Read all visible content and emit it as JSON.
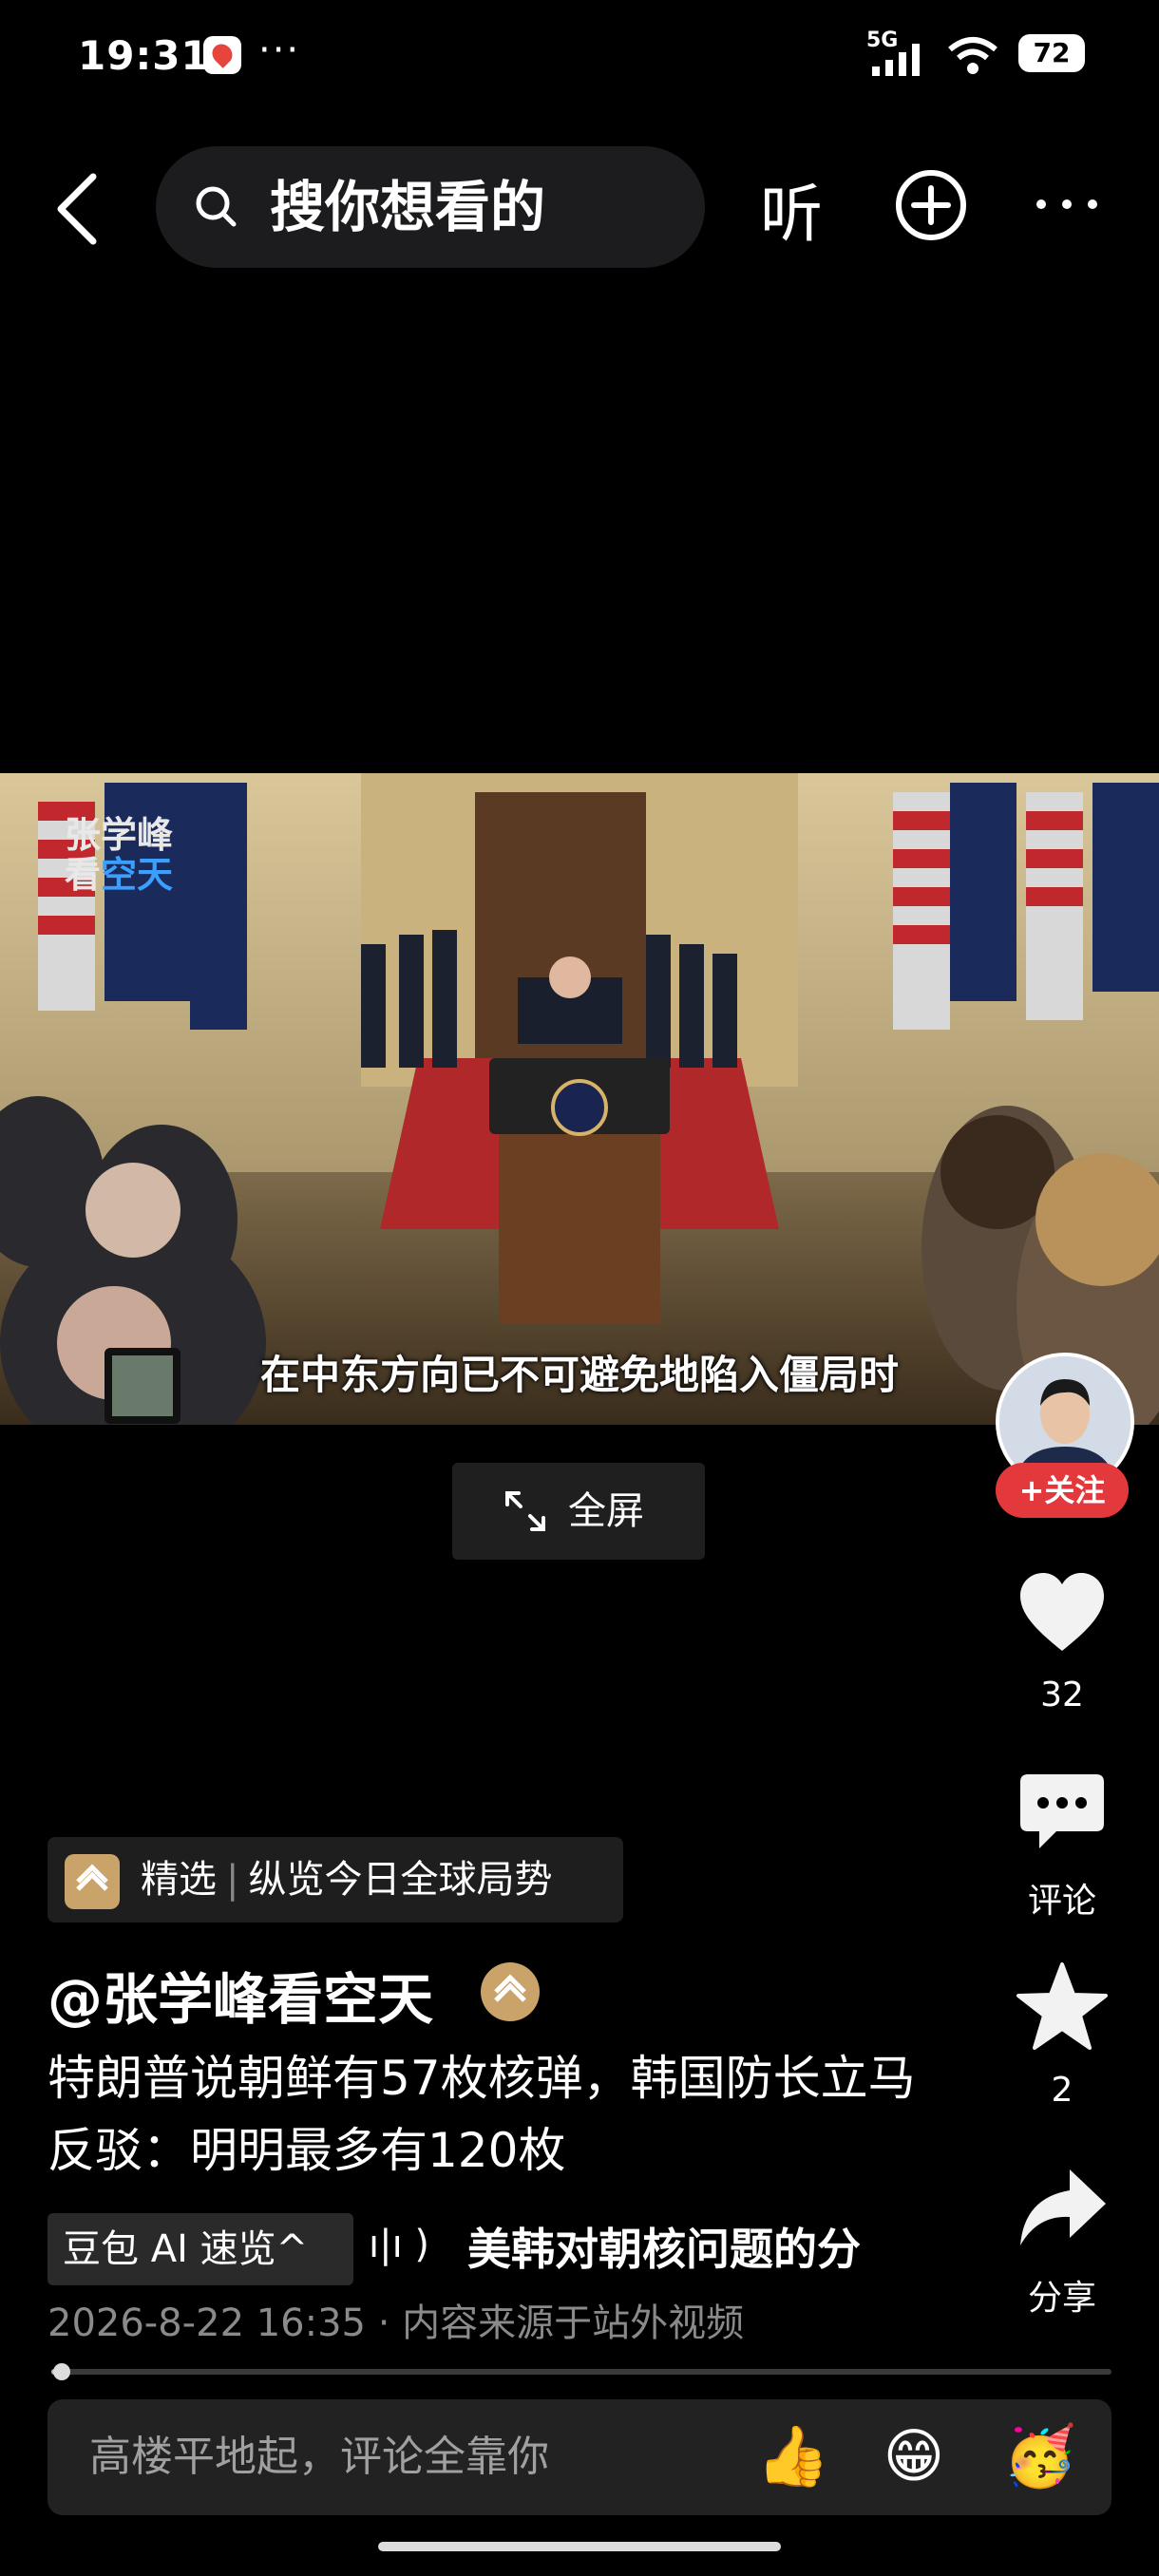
{
  "status_bar": {
    "time": "19:31",
    "dots": "···",
    "network": "5G",
    "battery": "72"
  },
  "top_bar": {
    "search_placeholder": "搜你想看的",
    "listen_label": "听"
  },
  "video": {
    "watermark_line1": "张学峰",
    "watermark_line2a": "看",
    "watermark_line2b": "空天",
    "subtitle": "在中东方向已不可避免地陷入僵局时"
  },
  "fullscreen_label": "全屏",
  "rail": {
    "follow_label": "+关注",
    "like_count": "32",
    "comment_label": "评论",
    "favorite_count": "2",
    "share_label": "分享"
  },
  "tag": {
    "badge": "精选",
    "text": "纵览今日全球局势"
  },
  "author": "@张学峰看空天",
  "description": "特朗普说朝鲜有57枚核弹，韩国防长立马反驳：明明最多有120枚",
  "ai": {
    "chip_label": "豆包 AI 速览^",
    "wave": "ı|ı )",
    "summary": "美韩对朝核问题的分"
  },
  "meta": {
    "datetime": "2026-8-22 16:35",
    "source": "内容来源于站外视频"
  },
  "progress": 0.01,
  "comment": {
    "placeholder": "高楼平地起，评论全靠你",
    "emoji_1": "👍",
    "emoji_2": "😁",
    "emoji_3": "🥳"
  },
  "colors": {
    "accent_red": "#e4393c",
    "badge_gold": "#c9a36a"
  }
}
